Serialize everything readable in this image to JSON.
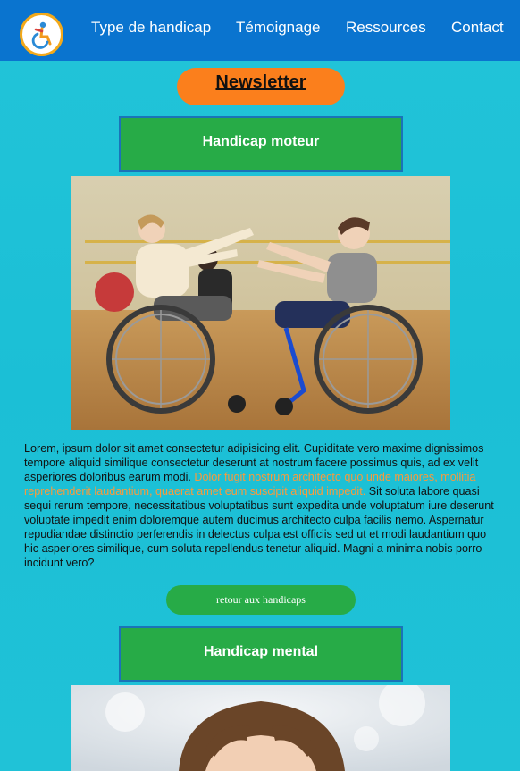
{
  "nav": {
    "logo_icon": "wheelchair-accessibility-logo",
    "links": [
      "Type de handicap",
      "Témoignage",
      "Ressources",
      "Contact"
    ]
  },
  "newsletter": {
    "label": "Newsletter"
  },
  "sections": [
    {
      "title": "Handicap moteur",
      "image": "children-in-wheelchairs-dancing-photo",
      "text_before": "Lorem, ipsum dolor sit amet consectetur adipisicing elit. Cupiditate vero maxime dignissimos tempore aliquid similique consectetur deserunt at nostrum facere possimus quis, ad ex velit asperiores doloribus earum modi. ",
      "text_highlight": "Dolor fugit nostrum architecto quo unde maiores, mollitia reprehenderit laudantium, quaerat amet eum suscipit aliquid impedit.",
      "text_after": " Sit soluta labore quasi sequi rerum tempore, necessitatibus voluptatibus sunt expedita unde voluptatum iure deserunt voluptate impedit enim doloremque autem ducimus architecto culpa facilis nemo. Aspernatur repudiandae distinctio perferendis in delectus culpa est officiis sed ut et modi laudantium quo hic asperiores similique, cum soluta repellendus tenetur aliquid. Magni a minima nobis porro incidunt vero?",
      "back_label": "retour aux handicaps"
    },
    {
      "title": "Handicap mental",
      "image": "child-portrait-photo"
    }
  ],
  "colors": {
    "nav_bg": "#0a74cf",
    "page_bg": "#1bbfd6",
    "accent_orange": "#fb7f1c",
    "section_green": "#27ab47",
    "highlight_text": "#fb9a3b"
  }
}
